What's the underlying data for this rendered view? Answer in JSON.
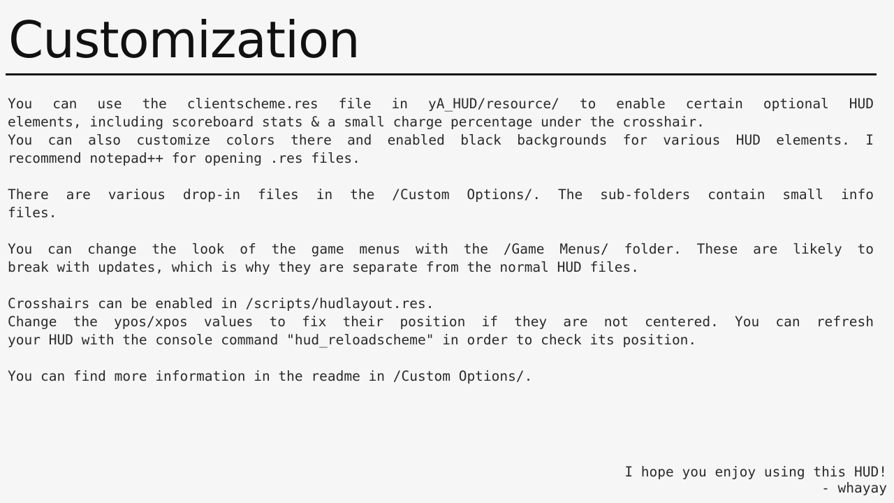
{
  "title": "Customization",
  "paragraphs": [
    {
      "lines": [
        "You can use the clientscheme.res file in yA_HUD/resource/ to enable certain optional HUD",
        "elements, including scoreboard stats & a small charge percentage under the crosshair.",
        "You can also customize colors there and enabled black backgrounds for various HUD elements. I",
        "recommend notepad++ for opening .res files."
      ]
    },
    {
      "lines": [
        "There are various drop-in files in the /Custom Options/. The sub-folders contain small info",
        "files."
      ]
    },
    {
      "lines": [
        "You can change the look of the game menus with the /Game Menus/ folder. These are likely to",
        "break with updates, which is why they are separate from the normal HUD files."
      ]
    },
    {
      "lines": [
        "Crosshairs can be enabled in /scripts/hudlayout.res.",
        "Change the ypos/xpos values to fix their position if they are not centered. You can refresh",
        "your HUD with the console command \"hud_reloadscheme\" in order to check its position."
      ]
    },
    {
      "lines": [
        "You can find more information in the readme in /Custom Options/."
      ]
    }
  ],
  "signoff": {
    "line1": "I hope you enjoy using this HUD!",
    "line2": "- whayay"
  }
}
